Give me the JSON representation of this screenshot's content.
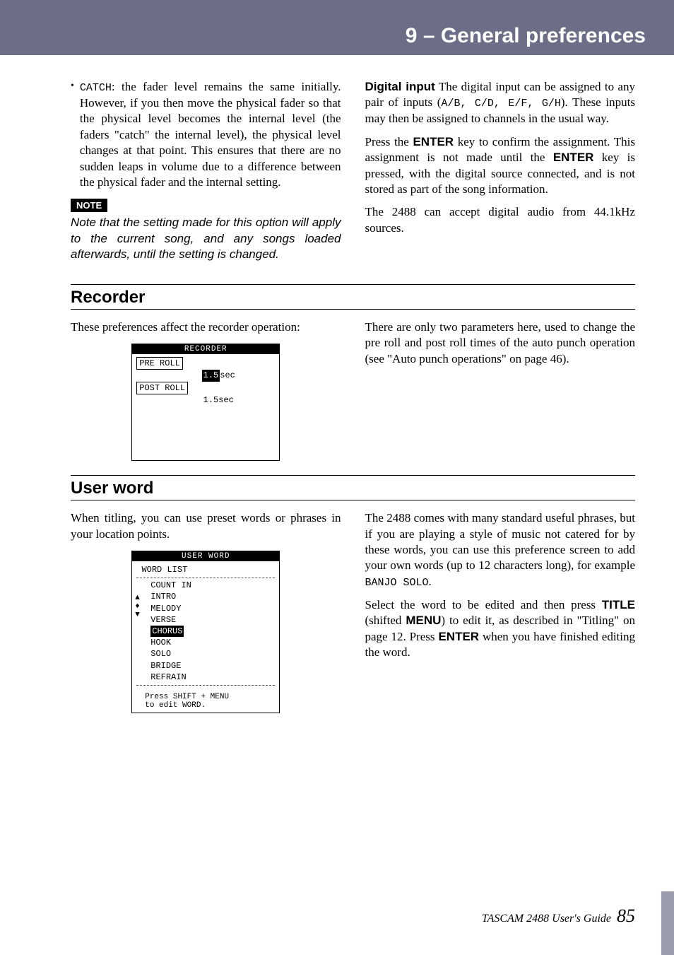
{
  "header": {
    "chapter_title": "9 – General preferences"
  },
  "col_left_top": {
    "bullet_term": "CATCH",
    "bullet_text": ": the fader level remains the same initially. However, if you then move the physical fader so that the physical level becomes the internal level (the faders \"catch\" the internal level), the physical level changes at that point. This ensures that there are no sudden leaps in volume due to a difference between the physical fader and the internal setting.",
    "note_label": "NOTE",
    "note_text": "Note that the setting made for this option will apply to the current song, and any songs loaded afterwards, until the setting is changed."
  },
  "col_right_top": {
    "digital_input_label": "Digital input",
    "digital_input_p1a": " The digital input can be assigned to any pair of inputs (",
    "digital_input_pairs": "A/B, C/D, E/F, G/H",
    "digital_input_p1b": "). These inputs may then be assigned to channels in the usual way.",
    "p2a": "Press the ",
    "enter": "ENTER",
    "p2b": " key to confirm the assignment. This assignment is not made until the ",
    "p2c": " key is pressed, with the digital source connected, and is not stored as part of the song information.",
    "p3": "The 2488 can accept digital audio from 44.1kHz sources."
  },
  "section_recorder": {
    "heading": "Recorder",
    "left_p": "These preferences affect the recorder operation:",
    "lcd": {
      "title": "RECORDER",
      "row1_label": "PRE ROLL",
      "row1_val": "1.5",
      "row1_unit": "sec",
      "row2_label": "POST ROLL",
      "row2_val": "1.5sec"
    },
    "right_p": "There are only two parameters here, used to change the pre roll and post roll times of the auto punch operation (see \"Auto punch operations\" on page 46)."
  },
  "section_userword": {
    "heading": "User word",
    "left_p": "When titling, you can use preset words or phrases in your location points.",
    "lcd": {
      "title": "USER WORD",
      "subtitle": "WORD LIST",
      "items": [
        "COUNT IN",
        "INTRO",
        "MELODY",
        "VERSE",
        "CHORUS",
        "HOOK",
        "SOLO",
        "BRIDGE",
        "REFRAIN"
      ],
      "selected_index": 4,
      "hint1": "Press SHIFT + MENU",
      "hint2": "to edit WORD."
    },
    "right_p1a": "The 2488 comes with many standard useful phrases, but if you are playing a style of music not catered for by these words, you can use this preference screen to add your own words (up to 12 characters long), for example ",
    "right_p1_example": "BANJO SOLO",
    "right_p1b": ".",
    "right_p2a": "Select the word to be edited and then press ",
    "title_key": "TITLE",
    "right_p2b": " (shifted ",
    "menu_key": "MENU",
    "right_p2c": ") to edit it, as described in \"Titling\" on page 12. Press ",
    "enter_key": "ENTER",
    "right_p2d": " when you have finished editing the word."
  },
  "footer": {
    "text": "TASCAM 2488 User's Guide",
    "page": "85"
  }
}
